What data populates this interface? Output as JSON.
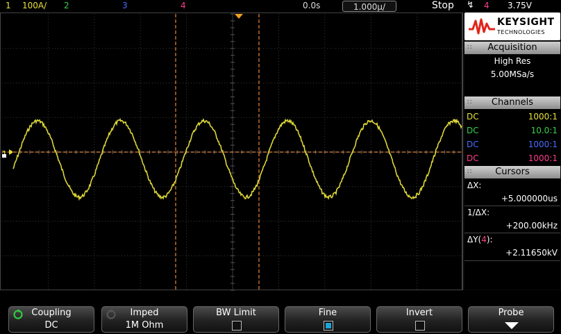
{
  "topbar": {
    "ch1_num": "1",
    "ch1_scale": "100A/",
    "ch2_num": "2",
    "ch3_num": "3",
    "ch4_num": "4",
    "delay": "0.0s",
    "timebase": "1.000µ/",
    "run_state": "Stop",
    "trigger_source": "4",
    "trigger_level": "3.75V",
    "colors": {
      "ch1": "#e8e23a",
      "ch2": "#3ad04a",
      "ch3": "#4a6cff",
      "ch4": "#ff3c8c",
      "cursor": "#e8863a"
    }
  },
  "screen": {
    "ground_marker": "1",
    "trigger_marker_color": "#f0a020"
  },
  "panel": {
    "logo": {
      "brand": "KEYSIGHT",
      "sub": "TECHNOLOGIES"
    },
    "acquisition": {
      "title": "Acquisition",
      "mode": "High Res",
      "rate": "5.00MSa/s"
    },
    "channels": {
      "title": "Channels",
      "rows": [
        {
          "coupling": "DC",
          "probe": "1000:1",
          "color": "#e8e23a"
        },
        {
          "coupling": "DC",
          "probe": "10.0:1",
          "color": "#3ad04a"
        },
        {
          "coupling": "DC",
          "probe": "1000:1",
          "color": "#4a6cff"
        },
        {
          "coupling": "DC",
          "probe": "1000:1",
          "color": "#ff3c8c"
        }
      ]
    },
    "cursors": {
      "title": "Cursors",
      "dx_label": "ΔX:",
      "dx_value": "+5.000000us",
      "inv_dx_label": "1/ΔX:",
      "inv_dx_value": "+200.00kHz",
      "dy_label_pre": "ΔY(",
      "dy_label_ch": "4",
      "dy_label_post": "):",
      "dy_value": "+2.11650kV"
    }
  },
  "softkeys": [
    {
      "title": "Coupling",
      "value": "DC",
      "icon": "rotate-knob-icon",
      "icon_color": "#2ecc40"
    },
    {
      "title": "Imped",
      "value": "1M Ohm",
      "icon": "rotate-knob-icon",
      "icon_color": "#555555"
    },
    {
      "title": "BW Limit",
      "checked": false
    },
    {
      "title": "Fine",
      "checked": true
    },
    {
      "title": "Invert",
      "checked": false
    },
    {
      "title": "Probe",
      "icon": "submenu-arrow-icon"
    }
  ]
}
